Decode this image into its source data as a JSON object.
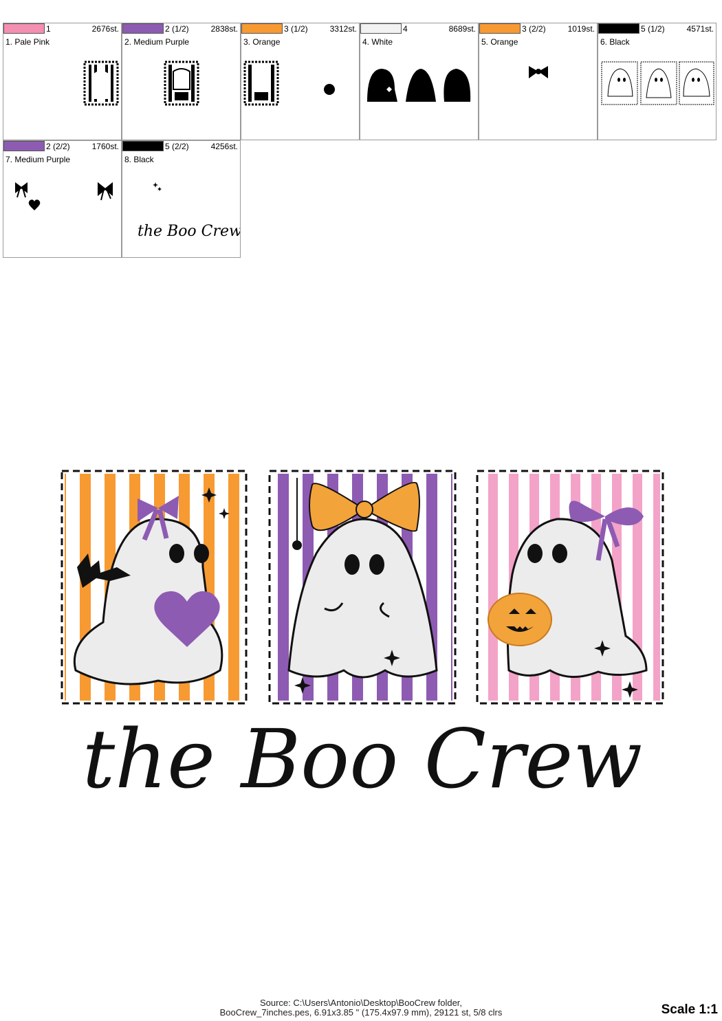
{
  "colors": [
    {
      "step": "1",
      "stitches": "2676st.",
      "name": "1. Pale Pink",
      "swatch": "#f48fb1",
      "thumb": "frame-pink"
    },
    {
      "step": "2 (1/2)",
      "stitches": "2838st.",
      "name": "2. Medium Purple",
      "swatch": "#8e5bb3",
      "thumb": "frame-purple"
    },
    {
      "step": "3 (1/2)",
      "stitches": "3312st.",
      "name": "3. Orange",
      "swatch": "#f79a32",
      "thumb": "frame-orange"
    },
    {
      "step": "4",
      "stitches": "8689st.",
      "name": "4. White",
      "swatch": "#f2f2f2",
      "thumb": "ghosts"
    },
    {
      "step": "3 (2/2)",
      "stitches": "1019st.",
      "name": "5. Orange",
      "swatch": "#f79a32",
      "thumb": "bow"
    },
    {
      "step": "5 (1/2)",
      "stitches": "4571st.",
      "name": "6. Black",
      "swatch": "#000000",
      "thumb": "outlines"
    },
    {
      "step": "2 (2/2)",
      "stitches": "1760st.",
      "name": "7. Medium Purple",
      "swatch": "#8e5bb3",
      "thumb": "bows-heart"
    },
    {
      "step": "5 (2/2)",
      "stitches": "4256st.",
      "name": "8. Black",
      "swatch": "#000000",
      "thumb": "text"
    }
  ],
  "design": {
    "title_text": "the Boo Crew",
    "thumb_text": "the Boo Crew"
  },
  "footer": {
    "source_line1": "Source: C:\\Users\\Antonio\\Desktop\\BooCrew folder,",
    "source_line2": "BooCrew_7inches.pes, 6.91x3.85 \" (175.4x97.9 mm), 29121 st, 5/8 clrs",
    "scale": "Scale 1:1"
  },
  "palette": {
    "orange": "#f79a32",
    "purple": "#8e5bb3",
    "pink": "#f4a3c8",
    "ghost": "#ececec",
    "black": "#111111"
  }
}
